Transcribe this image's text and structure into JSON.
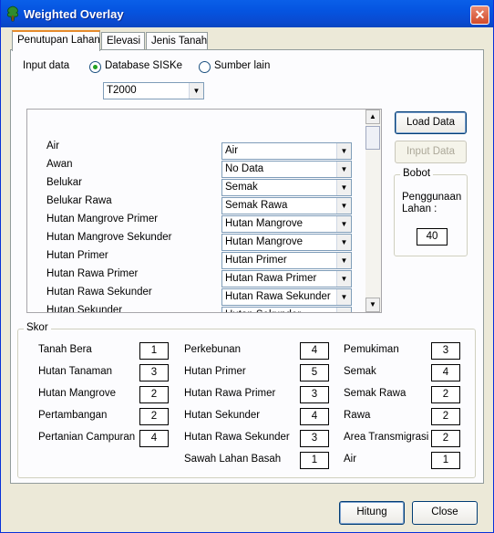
{
  "window": {
    "title": "Weighted Overlay",
    "close_label": "✕"
  },
  "tabs": [
    {
      "label": "Penutupan Lahan"
    },
    {
      "label": "Elevasi"
    },
    {
      "label": "Jenis Tanah"
    }
  ],
  "input": {
    "label": "Input data",
    "radio1": "Database SISKe",
    "radio2": "Sumber lain",
    "selected_radio": "radio1",
    "dataset_value": "T2000"
  },
  "mapping": [
    {
      "label": "Air",
      "value": "Air"
    },
    {
      "label": "Awan",
      "value": "No Data"
    },
    {
      "label": "Belukar",
      "value": "Semak"
    },
    {
      "label": "Belukar Rawa",
      "value": "Semak Rawa"
    },
    {
      "label": "Hutan Mangrove Primer",
      "value": "Hutan Mangrove"
    },
    {
      "label": "Hutan Mangrove Sekunder",
      "value": "Hutan Mangrove"
    },
    {
      "label": "Hutan Primer",
      "value": "Hutan Primer"
    },
    {
      "label": "Hutan Rawa Primer",
      "value": "Hutan Rawa Primer"
    },
    {
      "label": "Hutan Rawa Sekunder",
      "value": "Hutan Rawa Sekunder"
    },
    {
      "label": "Hutan Sekunder",
      "value": "Hutan Sekunder"
    }
  ],
  "buttons": {
    "load": "Load Data",
    "input": "Input Data",
    "hitung": "Hitung",
    "close": "Close"
  },
  "bobot": {
    "title": "Bobot",
    "label": "Penggunaan Lahan :",
    "value": "40"
  },
  "skor": {
    "title": "Skor",
    "columns": [
      [
        {
          "label": "Tanah Bera",
          "value": "1"
        },
        {
          "label": "Hutan Tanaman",
          "value": "3"
        },
        {
          "label": "Hutan Mangrove",
          "value": "2"
        },
        {
          "label": "Pertambangan",
          "value": "2"
        },
        {
          "label": "Pertanian Campuran",
          "value": "4"
        }
      ],
      [
        {
          "label": "Perkebunan",
          "value": "4"
        },
        {
          "label": "Hutan Primer",
          "value": "5"
        },
        {
          "label": "Hutan Rawa Primer",
          "value": "3"
        },
        {
          "label": "Hutan Sekunder",
          "value": "4"
        },
        {
          "label": "Hutan Rawa Sekunder",
          "value": "3"
        },
        {
          "label": "Sawah Lahan Basah",
          "value": "1"
        }
      ],
      [
        {
          "label": "Pemukiman",
          "value": "3"
        },
        {
          "label": "Semak",
          "value": "4"
        },
        {
          "label": "Semak Rawa",
          "value": "2"
        },
        {
          "label": "Rawa",
          "value": "2"
        },
        {
          "label": "Area Transmigrasi",
          "value": "2"
        },
        {
          "label": "Air",
          "value": "1"
        }
      ]
    ]
  }
}
